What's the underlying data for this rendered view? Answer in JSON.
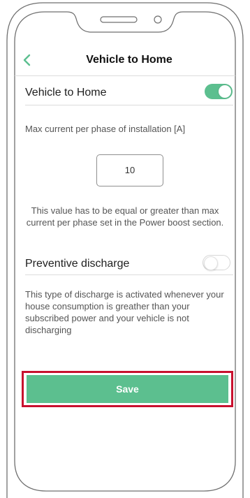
{
  "header": {
    "title": "Vehicle to Home",
    "back_icon": "chevron-left-icon"
  },
  "vehicle_to_home": {
    "label": "Vehicle to Home",
    "enabled": true
  },
  "max_current": {
    "label": "Max current per phase of installation [A]",
    "value": "10",
    "help_line1": "This value has to be equal or greater than max",
    "help_line2": "current per phase set in the Power boost section."
  },
  "preventive_discharge": {
    "label": "Preventive discharge",
    "enabled": false,
    "desc_line1": "This type of discharge is activated whenever your",
    "desc_line2": "house consumption is greather than your",
    "desc_line3": "subscribed power and your vehicle is not",
    "desc_line4": "discharging"
  },
  "save": {
    "label": "Save"
  },
  "colors": {
    "accent": "#5cbf8f",
    "highlight": "#c8102e",
    "frame": "#6f6f6f"
  }
}
